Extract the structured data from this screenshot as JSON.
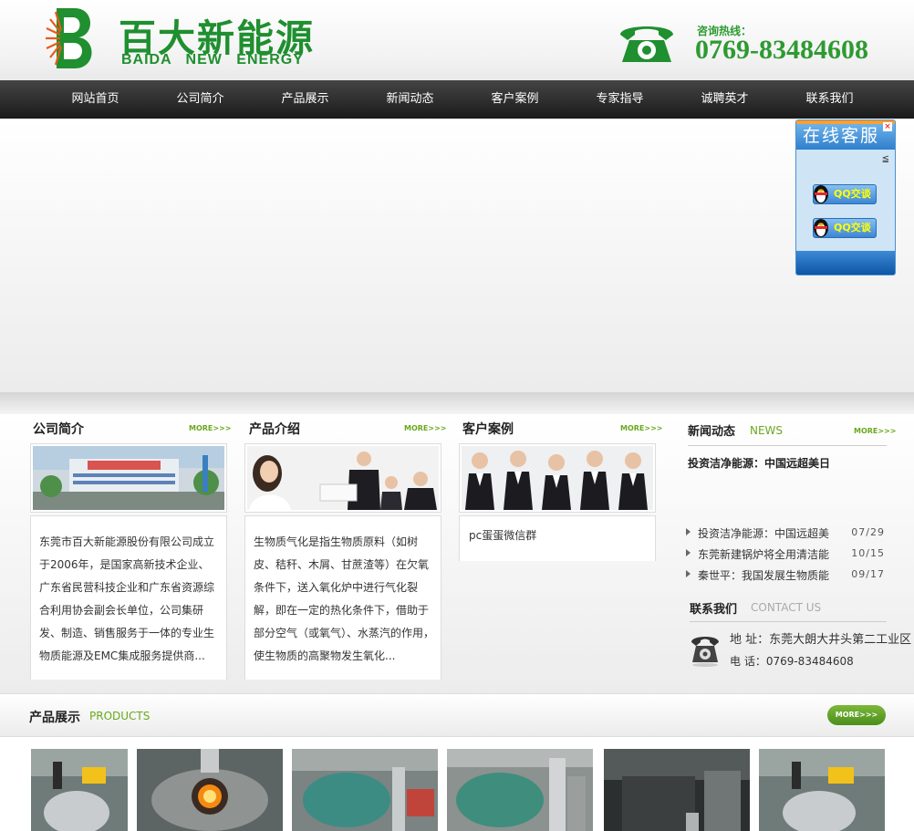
{
  "brand": {
    "name_cn": "百大新能源",
    "name_en": "BAIDA NEW ENERGY",
    "hotline_label": "咨询热线：",
    "hotline": "0769-83484608",
    "color": "#1f8f2f"
  },
  "nav": [
    "网站首页",
    "公司简介",
    "产品展示",
    "新闻动态",
    "客户案例",
    "专家指导",
    "诚聘英才",
    "联系我们"
  ],
  "kefu": {
    "title": "在线客服",
    "buttons": [
      "QQ交谈",
      "QQ交谈"
    ]
  },
  "sections": {
    "about": {
      "title": "公司简介",
      "more": "MORE>>>",
      "text": "东莞市百大新能源股份有限公司成立于2006年，是国家高新技术企业、广东省民营科技企业和广东省资源综合利用协会副会长单位，公司集研发、制造、销售服务于一体的专业生物质能源及EMC集成服务提供商..."
    },
    "products_intro": {
      "title": "产品介绍",
      "more": "MORE>>>",
      "text": "生物质气化是指生物质原料（如树皮、秸秆、木屑、甘蔗渣等）在欠氧条件下，送入氧化炉中进行气化裂解，即在一定的热化条件下，借助于部分空气（或氧气）、水蒸汽的作用，使生物质的高聚物发生氧化..."
    },
    "cases": {
      "title": "客户案例",
      "more": "MORE>>>",
      "caption": "pc蛋蛋微信群"
    },
    "news": {
      "title": "新闻动态",
      "title_en": "NEWS",
      "more": "MORE>>>",
      "headline": "投资洁净能源：中国远超美日",
      "items": [
        {
          "title": "投资洁净能源：中国远超美",
          "date": "07/29"
        },
        {
          "title": "东莞新建锅炉将全用清洁能",
          "date": "10/15"
        },
        {
          "title": "秦世平：我国发展生物质能",
          "date": "09/17"
        }
      ]
    },
    "contact": {
      "title": "联系我们",
      "title_en": "CONTACT US",
      "address": "地  址：东莞大朗大井头第二工业区",
      "phone": "电  话：0769-83484608"
    }
  },
  "products": {
    "title": "产品展示",
    "title_en": "PRODUCTS",
    "more": "MORE>>>",
    "images": [
      "product-1",
      "product-2",
      "product-3",
      "product-4",
      "product-5",
      "product-6"
    ]
  }
}
